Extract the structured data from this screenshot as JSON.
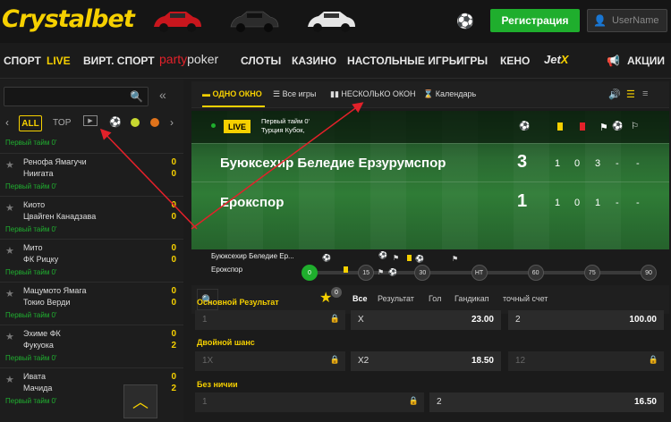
{
  "brand": {
    "logo": "Crystalbet",
    "accent": "#f6d000",
    "green": "#1fae2d"
  },
  "header": {
    "register_label": "Регистрация",
    "username_placeholder": "UserName",
    "ball_icon": "soccer-ball-icon",
    "user_icon": "user-icon"
  },
  "nav": {
    "items": [
      "СПОРТ",
      "LIVE",
      "ВИРТ. СПОРТ",
      "СЛОТЫ",
      "КАЗИНО",
      "НАСТОЛЬНЫЕ ИГРЫ",
      "ИГРЫ",
      "КЕНО",
      "АКЦИИ"
    ],
    "party_a": "party",
    "party_b": "poker",
    "jet_a": "Jet",
    "jet_b": "X"
  },
  "sidebar": {
    "tabs": {
      "all": "ALL",
      "top": "TOP"
    },
    "first_period": "Первый тайм 0'",
    "matches": [
      {
        "team1": "Ренофа Ямагучи",
        "team2": "Ниигата",
        "s1": "0",
        "s2": "0",
        "period": "Первый тайм 0'"
      },
      {
        "team1": "Киото",
        "team2": "Цвайген Канадзава",
        "s1": "0",
        "s2": "0",
        "period": "Первый тайм 0'"
      },
      {
        "team1": "Мито",
        "team2": "ФК Рицку",
        "s1": "0",
        "s2": "0",
        "period": "Первый тайм 0'"
      },
      {
        "team1": "Мацумото Ямага",
        "team2": "Токио Верди",
        "s1": "0",
        "s2": "0",
        "period": "Первый тайм 0'"
      },
      {
        "team1": "Эхиме ФК",
        "team2": "Фукуока",
        "s1": "0",
        "s2": "2",
        "period": "Первый тайм 0'"
      },
      {
        "team1": "Ивата",
        "team2": "Мачида",
        "s1": "0",
        "s2": "2",
        "period": "Первый тайм 0'"
      }
    ]
  },
  "main": {
    "tabs": {
      "one": "ОДНО ОКНО",
      "all": "Все игры",
      "multi": "НЕСКОЛЬКО ОКОН",
      "calendar": "Календарь"
    },
    "event": {
      "live": "LIVE",
      "period": "Первый тайм 0'",
      "league": "Турция Кубок,",
      "team1": "Буюксехир Беледие Ерзурумспор",
      "team2": "Ерокспор",
      "score1": "3",
      "score2": "1",
      "stats1": [
        "1",
        "0",
        "3",
        "-",
        "-"
      ],
      "stats2": [
        "1",
        "0",
        "1",
        "-",
        "-"
      ]
    },
    "timeline": {
      "team1": "Буюксехир Беледие Ер...",
      "team2": "Ерокспор",
      "ticks": [
        "0",
        "15",
        "30",
        "HT",
        "60",
        "75",
        "90"
      ],
      "progress": 0.0
    },
    "filters": {
      "badge": "0",
      "tabs": [
        "Все",
        "Результат",
        "Гол",
        "Гандикап",
        "точный счет"
      ]
    },
    "markets": [
      {
        "title": "Основной Результат",
        "odds": [
          {
            "label": "1",
            "value": "",
            "locked": true
          },
          {
            "label": "X",
            "value": "23.00",
            "locked": false
          },
          {
            "label": "2",
            "value": "100.00",
            "locked": false
          }
        ]
      },
      {
        "title": "Двойной шанс",
        "odds": [
          {
            "label": "1X",
            "value": "",
            "locked": true
          },
          {
            "label": "X2",
            "value": "18.50",
            "locked": false
          },
          {
            "label": "12",
            "value": "",
            "locked": true
          }
        ]
      },
      {
        "title": "Без ничии",
        "odds": [
          {
            "label": "1",
            "value": "",
            "locked": true
          },
          {
            "label": "2",
            "value": "16.50",
            "locked": false
          }
        ]
      }
    ]
  }
}
